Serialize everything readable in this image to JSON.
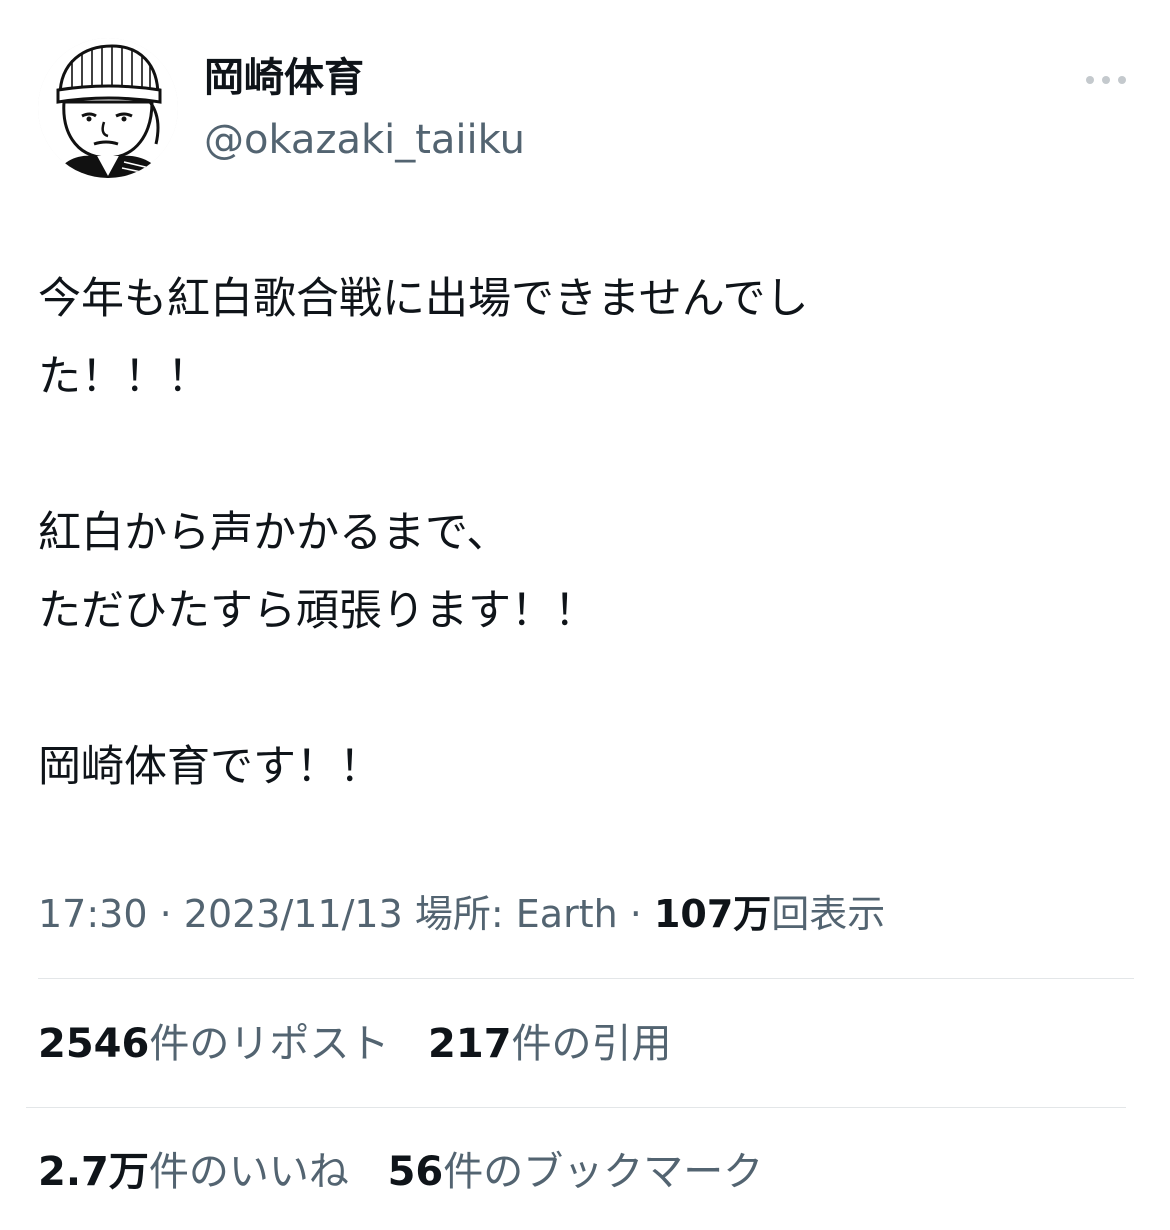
{
  "author": {
    "display_name": "岡崎体育",
    "handle": "@okazaki_taiiku",
    "avatar_icon": "illustrated-portrait-avatar"
  },
  "more_icon": "more-horizontal-icon",
  "tweet": {
    "lines": [
      "今年も紅白歌合戦に出場できませんでし",
      "た！！！",
      "",
      "紅白から声かかるまで、",
      "ただひたすら頑張ります！！",
      "",
      "岡崎体育です！！"
    ]
  },
  "meta": {
    "time": "17:30",
    "separator": " · ",
    "date": "2023/11/13",
    "location_prefix": "場所: ",
    "location": "Earth",
    "views_number": "107万",
    "views_label": "回表示"
  },
  "stats": {
    "reposts_number": "2546",
    "reposts_label": "件のリポスト",
    "quotes_number": "217",
    "quotes_label": "件の引用",
    "likes_number": "2.7万",
    "likes_label": "件のいいね",
    "bookmarks_number": "56",
    "bookmarks_label": "件のブックマーク"
  },
  "colors": {
    "text_primary": "#0f1419",
    "text_secondary": "#536471",
    "divider": "#e3e6e8"
  }
}
